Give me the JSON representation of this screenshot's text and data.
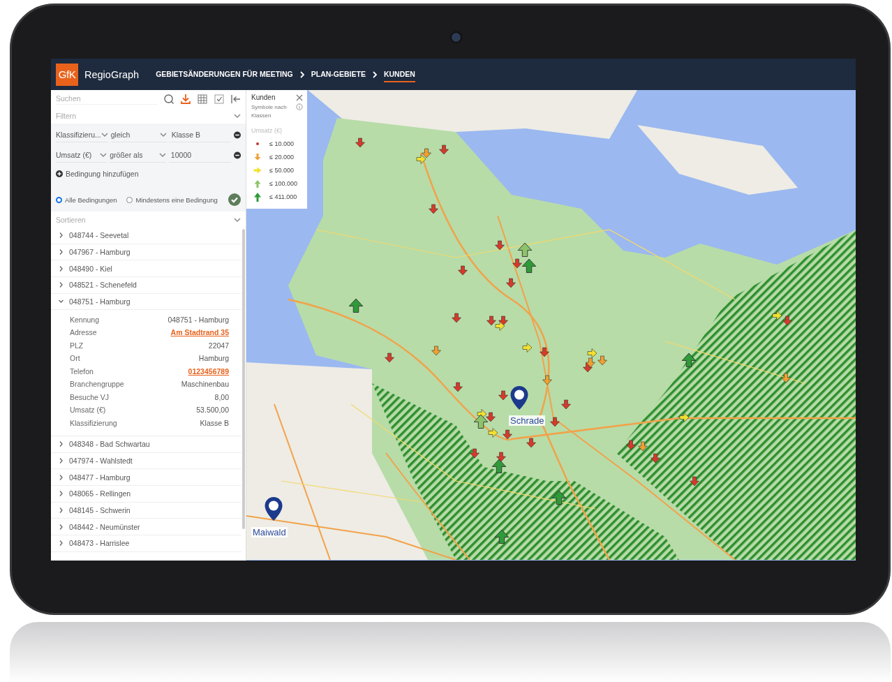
{
  "header": {
    "logo_text": "GfK",
    "app_name": "RegioGraph",
    "breadcrumbs": [
      {
        "label": "GEBIETSÄNDERUNGEN FÜR MEETING",
        "selected": false
      },
      {
        "label": "PLAN-GEBIETE",
        "selected": false
      },
      {
        "label": "KUNDEN",
        "selected": true
      }
    ]
  },
  "sidebar": {
    "search": {
      "placeholder": "Suchen"
    },
    "filter": {
      "label": "Filtern",
      "expanded": true,
      "conditions": [
        {
          "field": "Klassifizieru...",
          "operator": "gleich",
          "value": "Klasse B"
        },
        {
          "field": "Umsatz (€)",
          "operator": "größer als",
          "value": "10000"
        }
      ],
      "add_condition": "Bedingung hinzufügen",
      "match_options": [
        {
          "label": "Alle Bedingungen",
          "selected": true
        },
        {
          "label": "Mindestens eine Bedingung",
          "selected": false
        }
      ]
    },
    "sort": {
      "label": "Sortieren",
      "expanded": false
    },
    "customers": [
      {
        "label": "048744 - Seevetal",
        "expanded": false
      },
      {
        "label": "047967 - Hamburg",
        "expanded": false
      },
      {
        "label": "048490 - Kiel",
        "expanded": false
      },
      {
        "label": "048521 - Schenefeld",
        "expanded": false
      },
      {
        "label": "048751 - Hamburg",
        "expanded": true,
        "details": [
          {
            "label": "Kennung",
            "value": "048751 - Hamburg",
            "kind": "text"
          },
          {
            "label": "Adresse",
            "value": "Am Stadtrand 35",
            "kind": "link"
          },
          {
            "label": "PLZ",
            "value": "22047",
            "kind": "text"
          },
          {
            "label": "Ort",
            "value": "Hamburg",
            "kind": "text"
          },
          {
            "label": "Telefon",
            "value": "0123456789",
            "kind": "link"
          },
          {
            "label": "Branchengruppe",
            "value": "Maschinenbau",
            "kind": "text"
          },
          {
            "label": "Besuche VJ",
            "value": "8,00",
            "kind": "text"
          },
          {
            "label": "Umsatz (€)",
            "value": "53.500,00",
            "kind": "text"
          },
          {
            "label": "Klassifizierung",
            "value": "Klasse B",
            "kind": "text"
          }
        ]
      },
      {
        "label": "048348 - Bad Schwartau",
        "expanded": false
      },
      {
        "label": "047974 - Wahlstedt",
        "expanded": false
      },
      {
        "label": "048477 - Hamburg",
        "expanded": false
      },
      {
        "label": "048065 - Rellingen",
        "expanded": false
      },
      {
        "label": "048145 - Schwerin",
        "expanded": false
      },
      {
        "label": "048442 - Neumünster",
        "expanded": false
      },
      {
        "label": "048473 - Harrislee",
        "expanded": false
      }
    ]
  },
  "legend": {
    "title": "Kunden",
    "subtitle": "Symbole nach Klassen",
    "heading": "Umsatz (€)",
    "classes": [
      {
        "label": "≤ 10.000",
        "kind": "dot",
        "color": "#c0392b"
      },
      {
        "label": "≤ 20.000",
        "kind": "down",
        "color": "#f0a030"
      },
      {
        "label": "≤ 50.000",
        "kind": "right",
        "color": "#f2e030"
      },
      {
        "label": "≤ 100.000",
        "kind": "up",
        "color": "#8cc46a"
      },
      {
        "label": "≤ 411.000",
        "kind": "up-large",
        "color": "#2e9a38"
      }
    ]
  },
  "map": {
    "pins": [
      {
        "label": "Schrade"
      },
      {
        "label": "Maiwald"
      }
    ]
  }
}
